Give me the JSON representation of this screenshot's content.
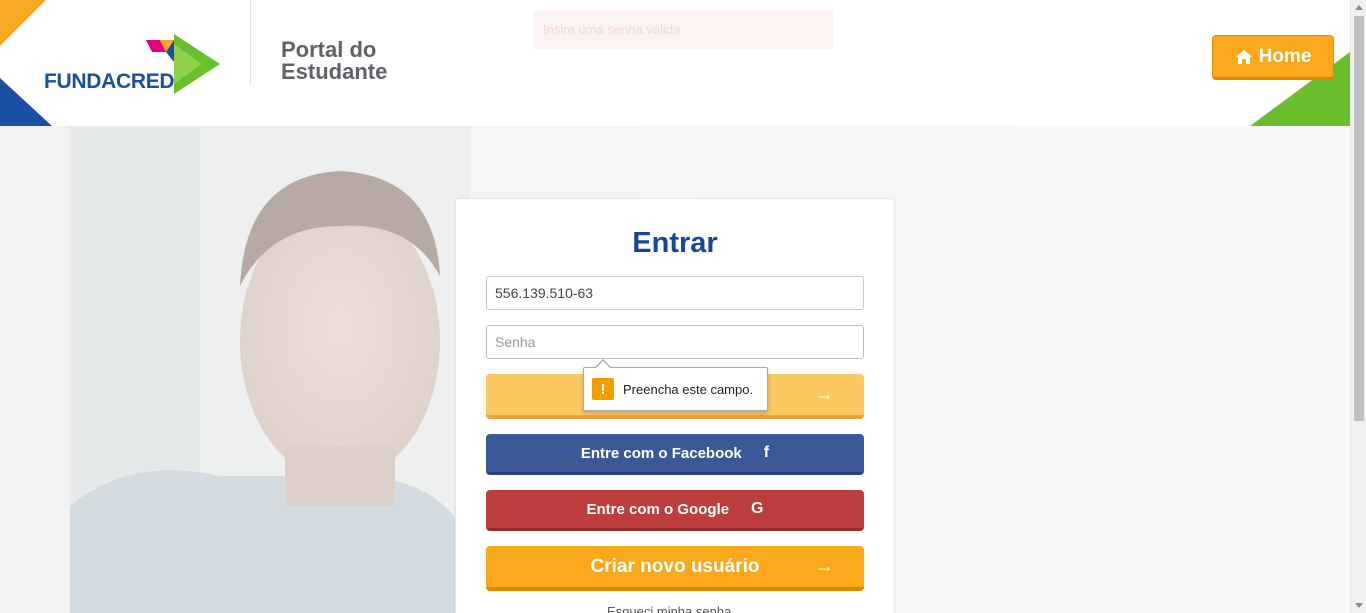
{
  "header": {
    "brand": "FUNDACRED",
    "portal_title_line1": "Portal do",
    "portal_title_line2": "Estudante",
    "home_label": "Home",
    "toast_message": "Insira uma senha válida"
  },
  "login": {
    "title": "Entrar",
    "cpf_value": "556.139.510-63",
    "password_placeholder": "Senha",
    "enter_arrow": "→",
    "facebook_label": "Entre com o Facebook",
    "facebook_icon": "f",
    "google_label": "Entre com o Google",
    "google_icon": "G",
    "create_label": "Criar novo usuário",
    "create_arrow": "→",
    "forgot_text": "Esqueci minha senha"
  },
  "validation_tooltip": {
    "icon": "!",
    "message": "Preencha este campo."
  },
  "colors": {
    "brand_blue": "#17479c",
    "accent_orange": "#f9a91a",
    "facebook_blue": "#3b5999",
    "google_red": "#bd3e3c",
    "brand_green": "#6cbf2c"
  }
}
